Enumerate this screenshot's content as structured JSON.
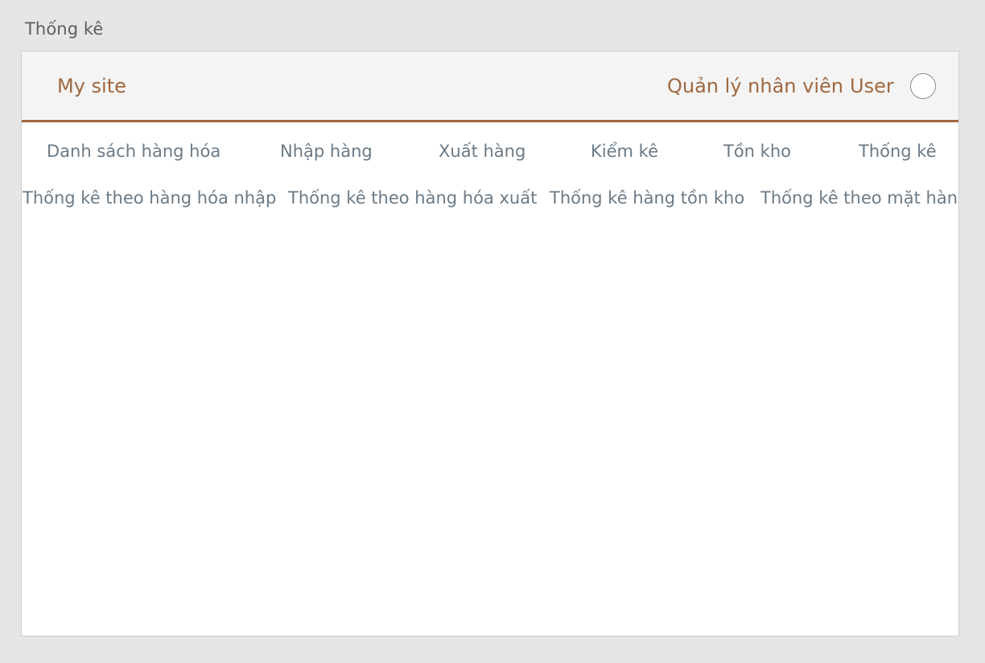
{
  "page": {
    "title": "Thống kê"
  },
  "header": {
    "brand": "My site",
    "manage_staff": "Quản lý nhân viên",
    "user": "User"
  },
  "menu": {
    "items": [
      "Danh sách hàng hóa",
      "Nhập hàng",
      "Xuất hàng",
      "Kiểm kê",
      "Tồn kho",
      "Thống kê"
    ]
  },
  "submenu": {
    "items": [
      "Thống kê theo hàng hóa nhập",
      "Thống kê theo hàng hóa xuất",
      "Thống kê hàng tồn kho",
      "Thống kê theo mặt hàng"
    ]
  },
  "colors": {
    "accent": "#a0683f",
    "nav_text": "#6b7a86",
    "header_bg": "#f4f4f4",
    "page_bg": "#e6e6e6"
  }
}
